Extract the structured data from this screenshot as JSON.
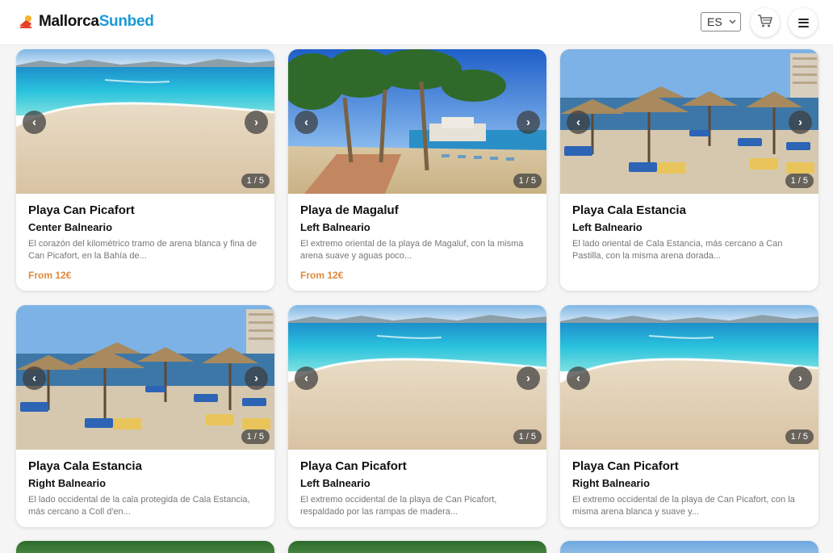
{
  "header": {
    "logo_part1": "Mallorca",
    "logo_part2": "Sunbed",
    "language": "ES",
    "brand_color": "#1a9ad6"
  },
  "icons": {
    "prev": "‹",
    "next": "›",
    "cart": "cart-icon",
    "menu": "menu-icon"
  },
  "cards": [
    {
      "title": "Playa Can Picafort",
      "subtitle": "Center Balneario",
      "description": "El corazón del kilométrico tramo de arena blanca y fina de Can Picafort, en la Bahía de...",
      "price": "From 12€",
      "counter": "1 / 5",
      "scene": "beach"
    },
    {
      "title": "Playa de Magaluf",
      "subtitle": "Left Balneario",
      "description": "El extremo oriental de la playa de Magaluf, con la misma arena suave y aguas poco...",
      "price": "From 12€",
      "counter": "1 / 5",
      "scene": "palms"
    },
    {
      "title": "Playa Cala Estancia",
      "subtitle": "Left Balneario",
      "description": "El lado oriental de Cala Estancia, más cercano a Can Pastilla, con la misma arena dorada...",
      "price": "",
      "counter": "1 / 5",
      "scene": "umbrellas"
    },
    {
      "title": "Playa Cala Estancia",
      "subtitle": "Right Balneario",
      "description": "El lado occidental de la cala protegida de Cala Estancia, más cercano a Coll d'en...",
      "price": "",
      "counter": "1 / 5",
      "scene": "umbrellas"
    },
    {
      "title": "Playa Can Picafort",
      "subtitle": "Left Balneario",
      "description": "El extremo occidental de la playa de Can Picafort, respaldado por las rampas de madera...",
      "price": "",
      "counter": "1 / 5",
      "scene": "beach"
    },
    {
      "title": "Playa Can Picafort",
      "subtitle": "Right Balneario",
      "description": "El extremo occidental de la playa de Can Picafort, con la misma arena blanca y suave y...",
      "price": "",
      "counter": "1 / 5",
      "scene": "beach"
    }
  ]
}
